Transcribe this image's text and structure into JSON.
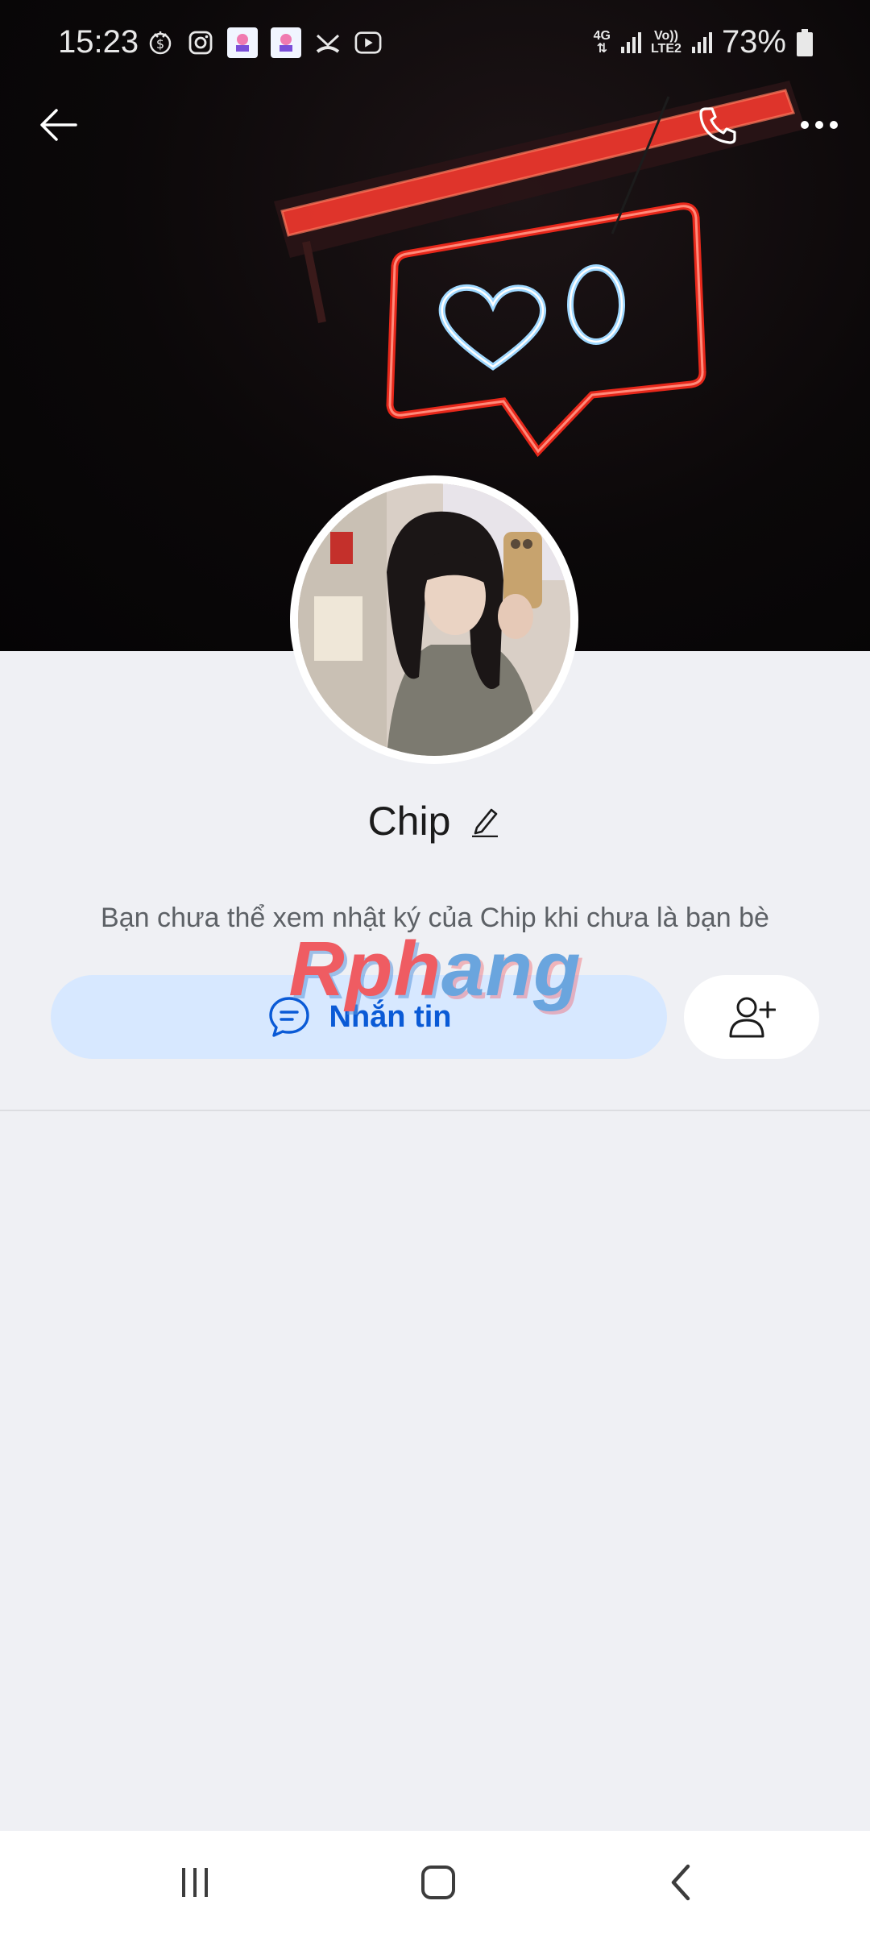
{
  "status_bar": {
    "time": "15:23",
    "network_top": "4G",
    "network2_top": "Vo))",
    "network2_bottom": "LTE2",
    "battery": "73%",
    "icons": [
      "money-notification-icon",
      "instagram-icon",
      "app-notification-icon",
      "app-notification-icon",
      "missed-call-icon",
      "youtube-icon",
      "signal-icon",
      "battery-icon"
    ]
  },
  "header": {
    "back_icon": "arrow-left-icon",
    "call_icon": "phone-icon",
    "more_icon": "more-dots-icon"
  },
  "profile": {
    "name": "Chip",
    "edit_icon": "pencil-icon",
    "info_text": "Bạn chưa thể xem nhật ký của Chip khi chưa là bạn bè"
  },
  "watermark": {
    "part1": "Rph",
    "part2": "ang"
  },
  "actions": {
    "message_label": "Nhắn tin",
    "message_icon": "chat-bubble-icon",
    "add_friend_icon": "add-friend-icon"
  },
  "colors": {
    "accent": "#0a5ad6",
    "message_button_bg": "#d7e8ff",
    "page_bg": "#eff0f4"
  }
}
